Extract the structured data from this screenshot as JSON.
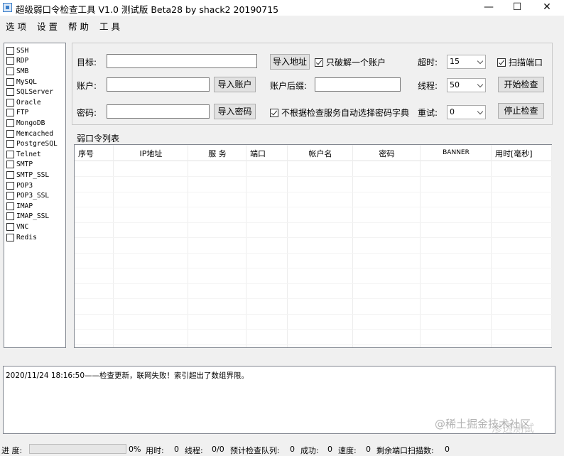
{
  "window": {
    "title": "超级弱口令检查工具 V1.0 测试版 Beta28 by shack2 20190715",
    "minimize_glyph": "—",
    "maximize_glyph": "☐",
    "close_glyph": "✕"
  },
  "menu": [
    "选 项",
    "设 置",
    "帮 助",
    "工 具"
  ],
  "services": [
    {
      "name": "SSH",
      "checked": false
    },
    {
      "name": "RDP",
      "checked": false
    },
    {
      "name": "SMB",
      "checked": false
    },
    {
      "name": "MySQL",
      "checked": false
    },
    {
      "name": "SQLServer",
      "checked": false
    },
    {
      "name": "Oracle",
      "checked": false
    },
    {
      "name": "FTP",
      "checked": false
    },
    {
      "name": "MongoDB",
      "checked": false
    },
    {
      "name": "Memcached",
      "checked": false
    },
    {
      "name": "PostgreSQL",
      "checked": false
    },
    {
      "name": "Telnet",
      "checked": false
    },
    {
      "name": "SMTP",
      "checked": false
    },
    {
      "name": "SMTP_SSL",
      "checked": false
    },
    {
      "name": "POP3",
      "checked": false
    },
    {
      "name": "POP3_SSL",
      "checked": false
    },
    {
      "name": "IMAP",
      "checked": false
    },
    {
      "name": "IMAP_SSL",
      "checked": false
    },
    {
      "name": "VNC",
      "checked": false
    },
    {
      "name": "Redis",
      "checked": false
    }
  ],
  "config": {
    "target_label": "目标:",
    "target_value": "",
    "import_address_button": "导入地址",
    "only_crack_one_label": "只破解一个账户",
    "only_crack_one_checked": true,
    "timeout_label": "超时:",
    "timeout_value": "15",
    "scan_port_label": "扫描端口",
    "scan_port_checked": true,
    "account_label": "账户:",
    "account_value": "",
    "import_account_button": "导入账户",
    "account_suffix_label": "账户后缀:",
    "account_suffix_value": "",
    "threads_label": "线程:",
    "threads_value": "50",
    "start_button": "开始检查",
    "password_label": "密码:",
    "password_value": "",
    "import_password_button": "导入密码",
    "no_auto_dict_label": "不根据检查服务自动选择密码字典",
    "no_auto_dict_checked": true,
    "retry_label": "重试:",
    "retry_value": "0",
    "stop_button": "停止检查"
  },
  "grid": {
    "title": "弱口令列表",
    "columns": [
      "序号",
      "IP地址",
      "服 务",
      "端口",
      "帐户名",
      "密码",
      "BANNER",
      "用时[毫秒]"
    ],
    "rows": []
  },
  "log": {
    "lines": [
      "2020/11/24 18:16:50——检查更新，联网失败！索引超出了数组界限。"
    ]
  },
  "watermark": {
    "line1": "@稀土掘金技术社区",
    "line2": "渗透测试"
  },
  "status": {
    "progress_label": "进 度:",
    "progress_value": 0,
    "progress_text": "0%",
    "elapsed_label": "用时:",
    "elapsed_value": "0",
    "threads_label": "线程:",
    "threads_value": "0/0",
    "queue_label": "预计检查队列:",
    "queue_value": "0",
    "success_label": "成功:",
    "success_value": "0",
    "speed_label": "速度:",
    "speed_value": "0",
    "remaining_label": "剩余端口扫描数:",
    "remaining_value": "0"
  }
}
